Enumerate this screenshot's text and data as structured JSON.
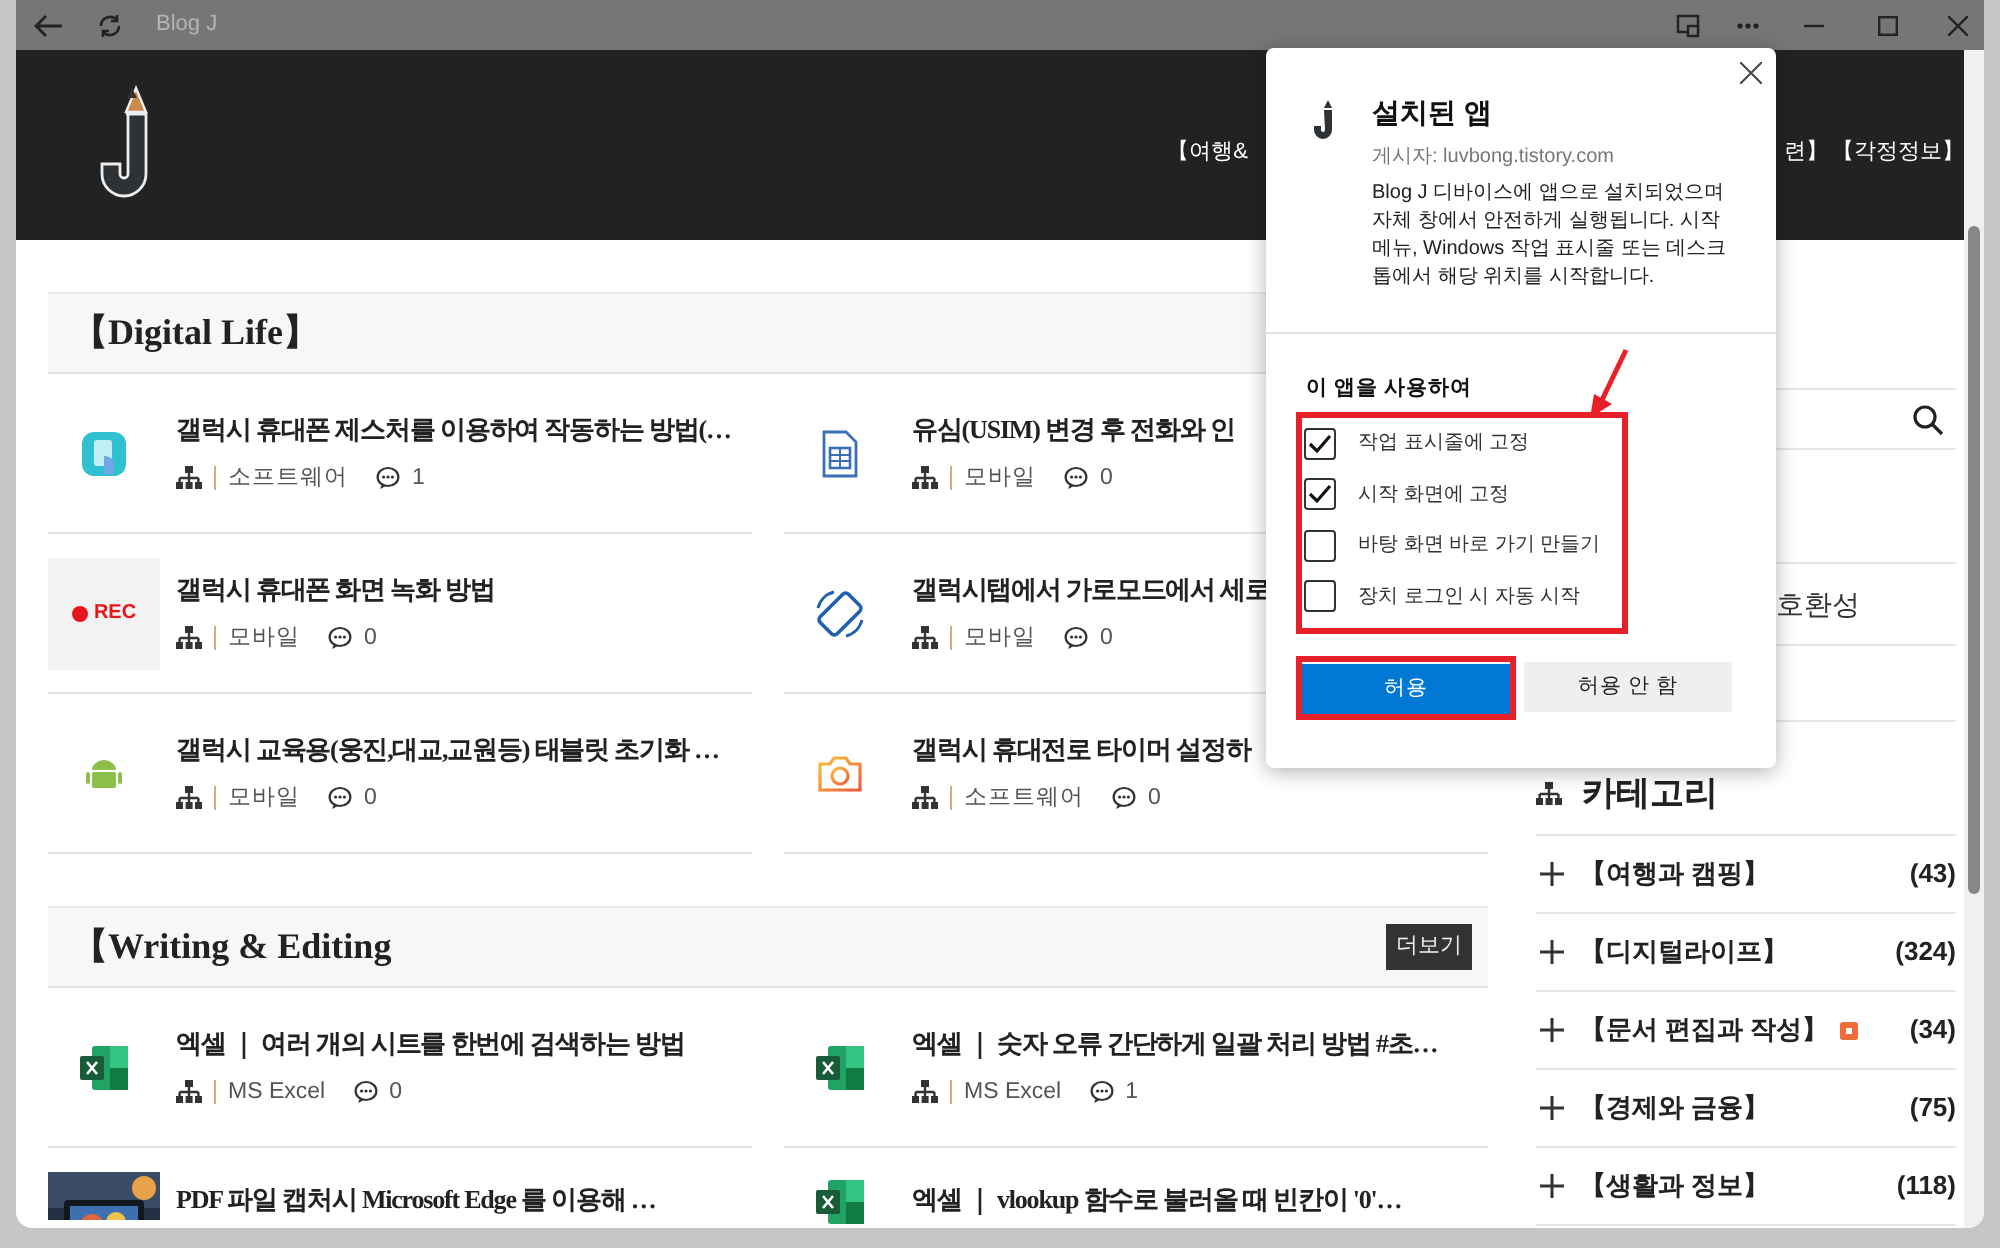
{
  "window": {
    "title": "Blog J"
  },
  "header": {
    "nav": [
      "【여행&",
      "련】",
      "【각정정보】"
    ]
  },
  "sections": [
    {
      "title": "【Digital Life】",
      "posts": [
        {
          "title": "갤럭시 휴대폰 제스처를 이용하여 작동하는 방법(…",
          "thumb": {
            "kind": "touch"
          },
          "category": "소프트웨어",
          "comments": "1"
        },
        {
          "title": "유심(USIM) 변경 후 전화와 인",
          "thumb": {
            "kind": "sim"
          },
          "category": "모바일",
          "comments": "0"
        },
        {
          "title": "갤럭시 휴대폰 화면 녹화 방법",
          "thumb": {
            "kind": "rec",
            "label": "REC"
          },
          "category": "모바일",
          "comments": "0"
        },
        {
          "title": "갤럭시탭에서 가로모드에서 세로",
          "thumb": {
            "kind": "rotate"
          },
          "category": "모바일",
          "comments": "0"
        },
        {
          "title": "갤럭시 교육용(웅진,대교,교원등) 태블릿 초기화 …",
          "thumb": {
            "kind": "android"
          },
          "category": "모바일",
          "comments": "0"
        },
        {
          "title": "갤럭시 휴대전로 타이머 설정하",
          "thumb": {
            "kind": "camera"
          },
          "category": "소프트웨어",
          "comments": "0"
        }
      ]
    },
    {
      "title": "【Writing & Editing",
      "more": "더보기",
      "posts": [
        {
          "title": "엑셀 ｜ 여러 개의 시트를 한번에 검색하는 방법",
          "thumb": {
            "kind": "excel"
          },
          "category": "MS Excel",
          "comments": "0"
        },
        {
          "title": "엑셀 ｜ 숫자 오류 간단하게 일괄 처리 방법 #초…",
          "thumb": {
            "kind": "excel"
          },
          "category": "MS Excel",
          "comments": "1"
        },
        {
          "title": "PDF 파일 캡처시 Microsoft Edge 를 이용해 …"
        },
        {
          "title": "엑셀 ｜ vlookup 함수로 불러올 때 빈칸이 '0'…",
          "thumb": {
            "kind": "excel"
          }
        }
      ]
    }
  ],
  "sidebar": {
    "snippet": "호환성",
    "categories_title": "카테고리",
    "categories": [
      {
        "name": "【여행과 캠핑】",
        "count": "(43)",
        "badge": false
      },
      {
        "name": "【디지털라이프】",
        "count": "(324)",
        "badge": false
      },
      {
        "name": "【문서 편집과 작성】",
        "count": "(34)",
        "badge": true
      },
      {
        "name": "【경제와 금융】",
        "count": "(75)",
        "badge": false
      },
      {
        "name": "【생활과 정보】",
        "count": "(118)",
        "badge": false
      }
    ]
  },
  "dialog": {
    "title": "설치된 앱",
    "publisher": "게시자: luvbong.tistory.com",
    "description": "Blog J 디바이스에 앱으로 설치되었으며 자체 창에서 안전하게 실행됩니다. 시작 메뉴, Windows 작업 표시줄 또는 데스크톱에서 해당 위치를 시작합니다.",
    "options_title": "이 앱을 사용하여",
    "options": [
      {
        "label": "작업 표시줄에 고정",
        "checked": true
      },
      {
        "label": "시작 화면에 고정",
        "checked": true
      },
      {
        "label": "바탕 화면 바로 가기 만들기",
        "checked": false
      },
      {
        "label": "장치 로그인 시 자동 시작",
        "checked": false
      }
    ],
    "buttons": [
      {
        "label": "허용",
        "kind": "primary"
      },
      {
        "label": "허용 안 함",
        "kind": "secondary"
      }
    ]
  }
}
